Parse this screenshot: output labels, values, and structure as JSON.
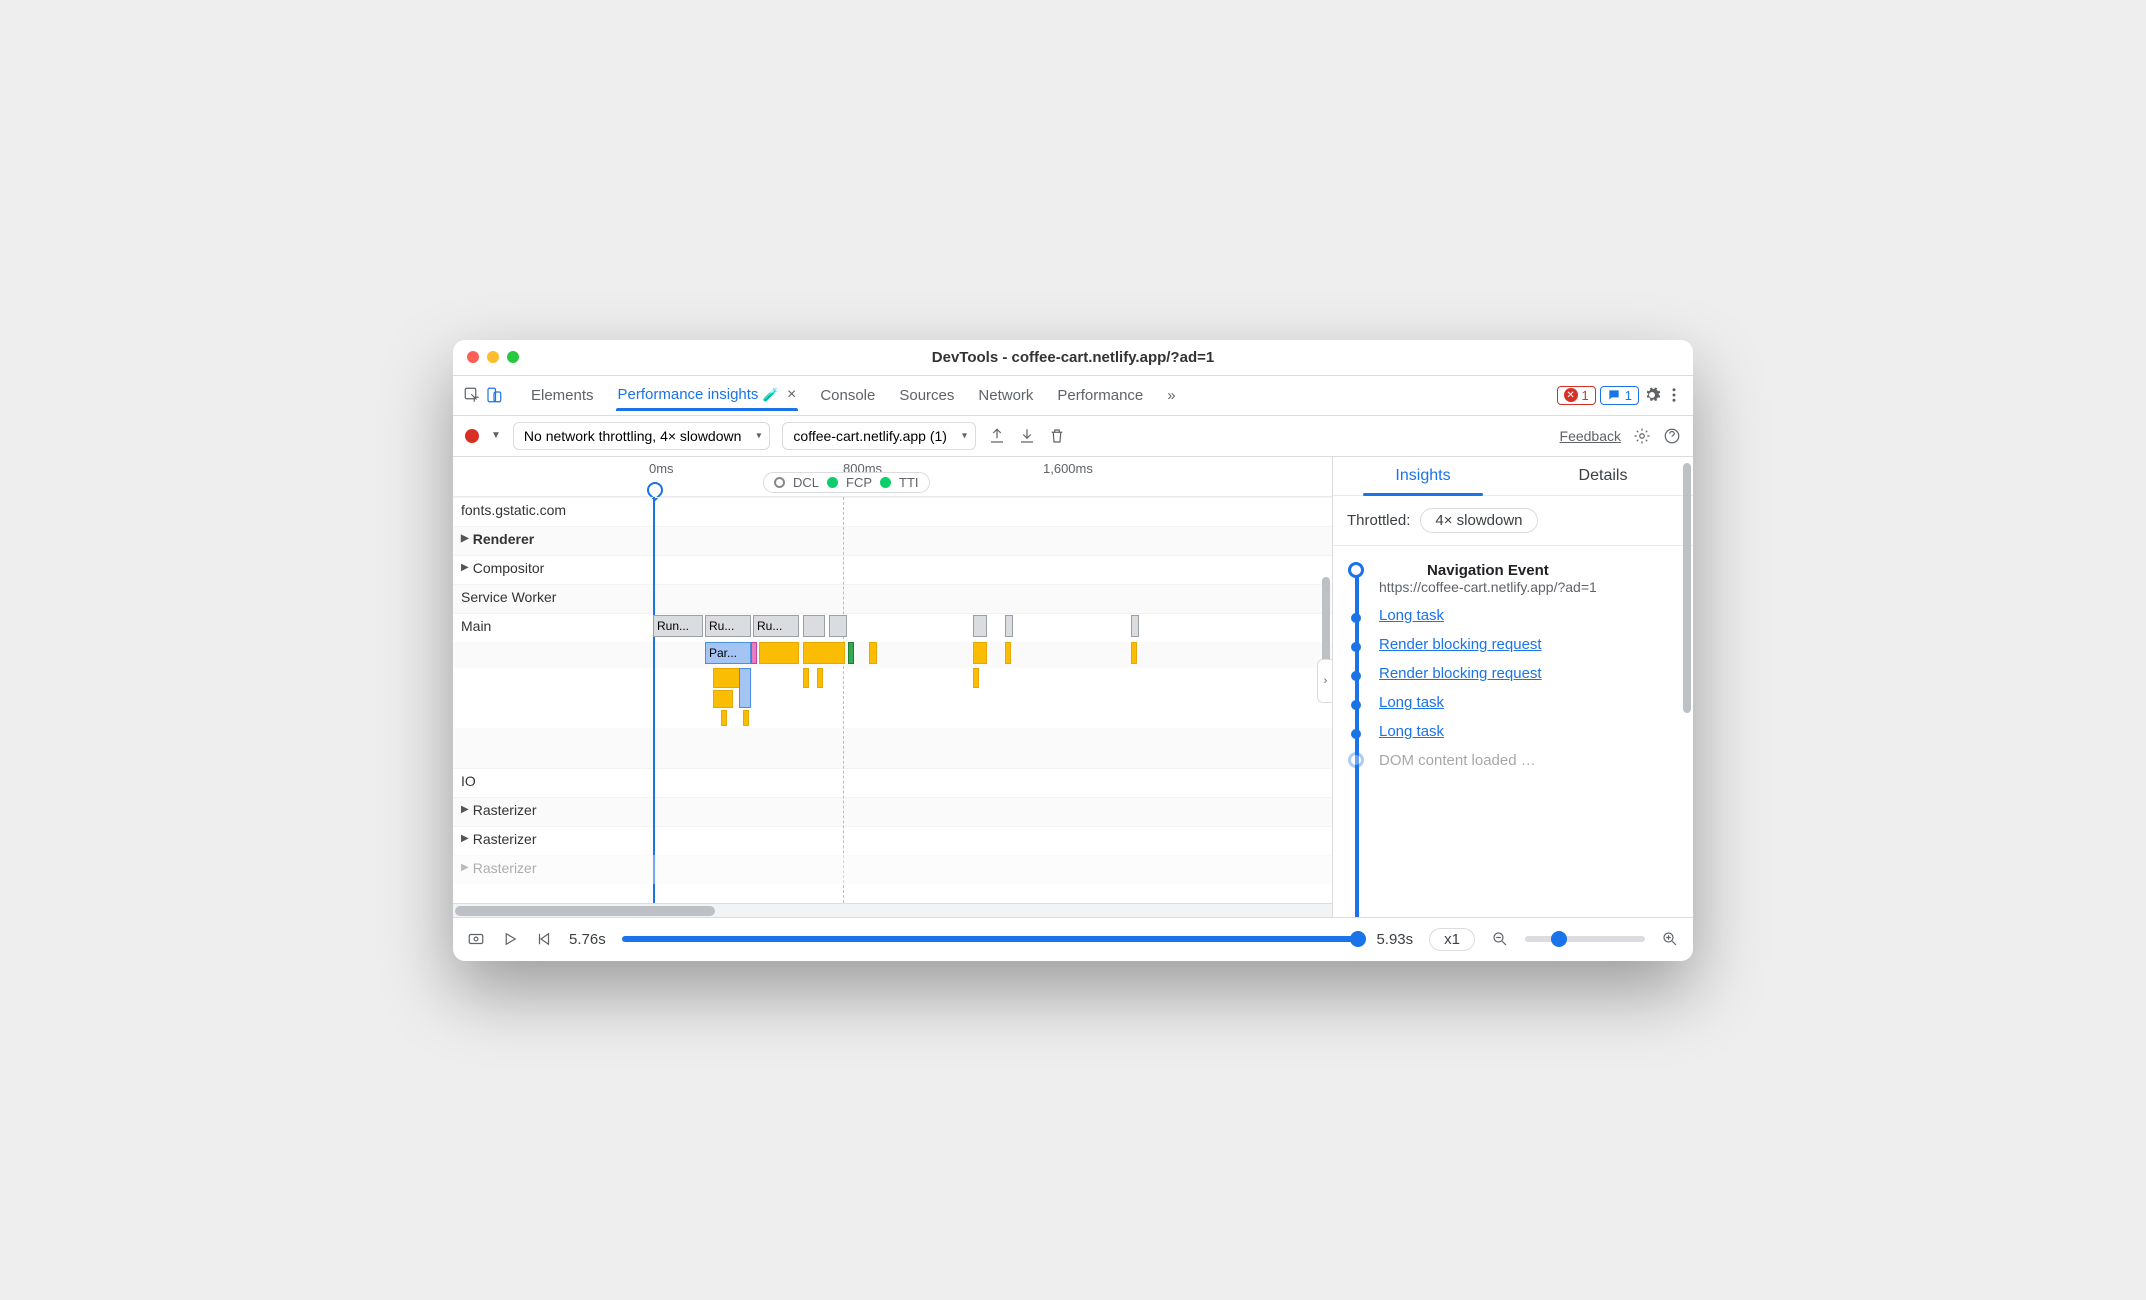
{
  "window_title": "DevTools - coffee-cart.netlify.app/?ad=1",
  "top_tabs": {
    "items": [
      "Elements",
      "Performance insights",
      "Console",
      "Sources",
      "Network",
      "Performance"
    ],
    "active_index": 1,
    "overflow_glyph": "»",
    "error_badge": "1",
    "message_badge": "1",
    "close_glyph": "×",
    "experiment_glyph": "🧪"
  },
  "toolbar": {
    "throttling_select": "No network throttling, 4× slowdown",
    "target_select": "coffee-cart.netlify.app (1)",
    "feedback": "Feedback"
  },
  "ruler": {
    "ticks": [
      "0ms",
      "800ms",
      "1,600ms"
    ],
    "markers": {
      "dcl": "DCL",
      "fcp": "FCP",
      "tti": "TTI"
    }
  },
  "tracks": {
    "rows": [
      {
        "label": "fonts.gstatic.com",
        "type": "net",
        "expandable": false
      },
      {
        "label": "Renderer",
        "type": "group",
        "bold": true,
        "expandable": true
      },
      {
        "label": "Compositor",
        "type": "thread",
        "expandable": true
      },
      {
        "label": "Service Worker",
        "type": "thread",
        "expandable": false
      },
      {
        "label": "Main",
        "type": "thread",
        "expandable": false,
        "tasks": [
          "Run...",
          "Ru...",
          "Ru..."
        ],
        "subtask": "Par..."
      },
      {
        "label": "",
        "type": "flame"
      },
      {
        "label": "",
        "type": "flame2"
      },
      {
        "label": "",
        "type": "spacer"
      },
      {
        "label": "IO",
        "type": "thread",
        "expandable": false
      },
      {
        "label": "Rasterizer",
        "type": "thread",
        "expandable": true
      },
      {
        "label": "Rasterizer",
        "type": "thread",
        "expandable": true
      },
      {
        "label": "Rasterizer",
        "type": "thread",
        "expandable": true
      }
    ]
  },
  "insights": {
    "tabs": [
      "Insights",
      "Details"
    ],
    "active_tab": 0,
    "throttled_label": "Throttled:",
    "throttled_value": "4× slowdown",
    "nav_title": "Navigation Event",
    "nav_url": "https://coffee-cart.netlify.app/?ad=1",
    "items": [
      "Long task",
      "Render blocking request",
      "Render blocking request",
      "Long task",
      "Long task"
    ]
  },
  "bottom": {
    "time_current": "5.76s",
    "time_end": "5.93s",
    "speed": "x1"
  }
}
